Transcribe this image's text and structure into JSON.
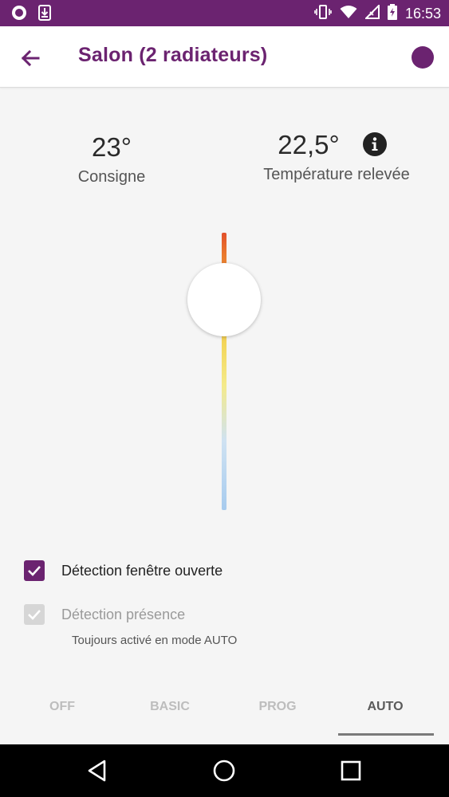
{
  "status_bar": {
    "time": "16:53",
    "icons": [
      "circle-notification-icon",
      "download-icon",
      "vibrate-icon",
      "wifi-icon",
      "no-signal-icon",
      "battery-charging-icon"
    ]
  },
  "header": {
    "title": "Salon (2 radiateurs)",
    "back_icon": "arrow-left-icon",
    "status_color": "#6b2370"
  },
  "temperatures": {
    "setpoint": {
      "value": "23°",
      "label": "Consigne"
    },
    "measured": {
      "value": "22,5°",
      "label": "Température relevée",
      "info_icon": "info-icon"
    }
  },
  "slider": {
    "gradient": [
      "#e2502b",
      "#f3d65a",
      "#a7cbee"
    ]
  },
  "options": {
    "window_detection": {
      "label": "Détection fenêtre ouverte",
      "checked": true
    },
    "presence_detection": {
      "label": "Détection présence",
      "checked": true,
      "disabled": true,
      "note": "Toujours activé en mode AUTO"
    }
  },
  "modes": {
    "tabs": [
      "OFF",
      "BASIC",
      "PROG",
      "AUTO"
    ],
    "selected": "AUTO"
  },
  "nav": {
    "icons": [
      "triangle-back-icon",
      "circle-home-icon",
      "square-recents-icon"
    ]
  },
  "colors": {
    "accent": "#6b2370",
    "disabled": "#bdbdbd"
  }
}
